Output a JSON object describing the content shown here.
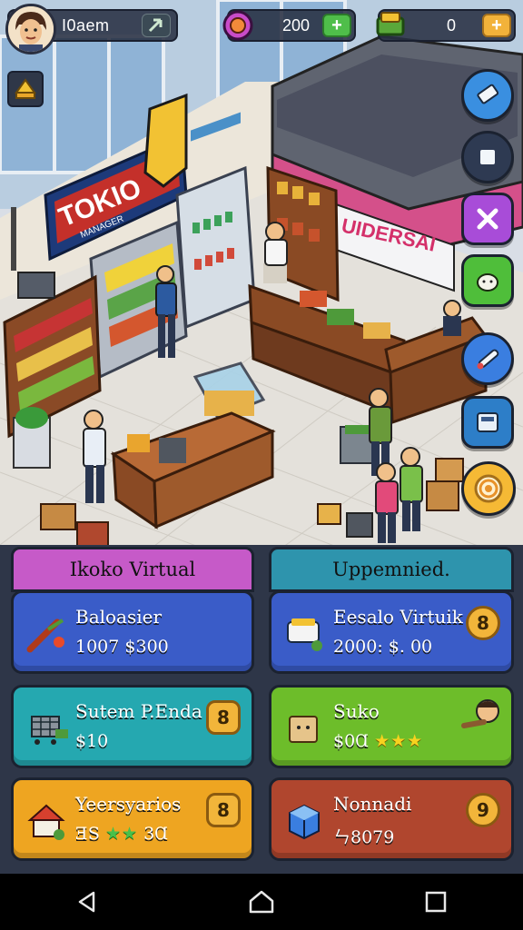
{
  "hud": {
    "player_name": "I0aem",
    "gems": "200",
    "cash": "0",
    "gem_add_symbol": "+",
    "cash_add_symbol": "+"
  },
  "scene": {
    "shop_sign_left": "TOKIO",
    "shop_sign_left_sub": "MANAGER",
    "shop_sign_right": "UIDERSAI"
  },
  "sections": [
    {
      "title": "Ikoko Virtual",
      "color": "#c04fc0"
    },
    {
      "title": "Uppemnied.",
      "color": "#2a8fa8"
    }
  ],
  "cards": [
    {
      "title": "Baloasier",
      "subtitle": "1007 $300",
      "level": "",
      "color": "#3a5cc8",
      "icon": "chili-icon"
    },
    {
      "title": "Eesalo Virtuik",
      "subtitle": "2000: $. 00",
      "level": "8",
      "color": "#3a5cc8",
      "icon": "food-tray-icon"
    },
    {
      "title": "Sutem P.Enda",
      "subtitle": "$10",
      "level": "8",
      "color": "#25a8b0",
      "icon": "shopping-cart-icon"
    },
    {
      "title": "Suko",
      "subtitle": "$0Ɑ",
      "stars": "★★★",
      "level": "",
      "color": "#6dbd2a",
      "icon": "box-icon"
    },
    {
      "title": "Yeersyarios",
      "subtitle": "ƎS",
      "stars": "★★",
      "subtitle2": "3Ɑ",
      "level": "8",
      "color": "#eea521",
      "icon": "house-icon"
    },
    {
      "title": "Nonnadi",
      "subtitle": "ㄣ8079",
      "level": "9",
      "color": "#b0462e",
      "icon": "cube-icon"
    }
  ],
  "colors": {
    "hud_bg": "#283042",
    "gem_add": "#4fbe4a",
    "cash_add": "#f2b23a",
    "level_badge": "#f2b53a"
  }
}
